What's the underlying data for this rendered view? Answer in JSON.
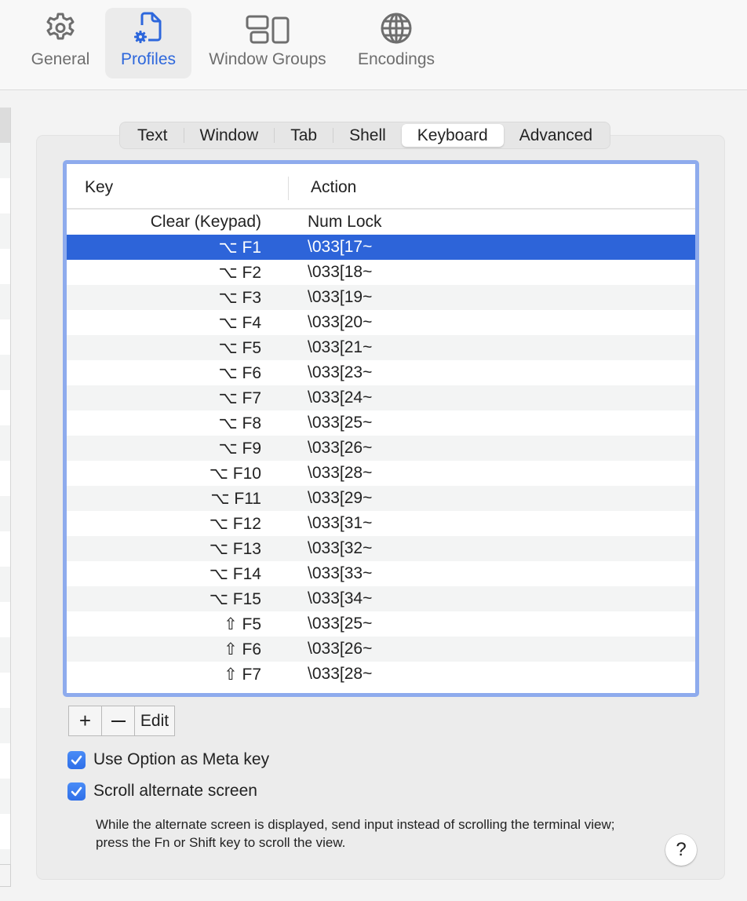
{
  "toolbar": {
    "items": [
      {
        "label": "General",
        "icon": "gear-icon",
        "active": false
      },
      {
        "label": "Profiles",
        "icon": "profile-document-gear-icon",
        "active": true
      },
      {
        "label": "Window Groups",
        "icon": "window-groups-icon",
        "active": false
      },
      {
        "label": "Encodings",
        "icon": "globe-icon",
        "active": false
      }
    ]
  },
  "colors": {
    "accent": "#2d67dc",
    "selection": "#2d64d9",
    "focus_ring": "#8eabed",
    "checkbox": "#3478f6"
  },
  "tabs": {
    "items": [
      "Text",
      "Window",
      "Tab",
      "Shell",
      "Keyboard",
      "Advanced"
    ],
    "selected": "Keyboard"
  },
  "table": {
    "columns": {
      "key": "Key",
      "action": "Action"
    },
    "selected_index": 1,
    "rows": [
      {
        "key": "Clear (Keypad)",
        "action": "Num Lock"
      },
      {
        "key": "⌥ F1",
        "action": "\\033[17~"
      },
      {
        "key": "⌥ F2",
        "action": "\\033[18~"
      },
      {
        "key": "⌥ F3",
        "action": "\\033[19~"
      },
      {
        "key": "⌥ F4",
        "action": "\\033[20~"
      },
      {
        "key": "⌥ F5",
        "action": "\\033[21~"
      },
      {
        "key": "⌥ F6",
        "action": "\\033[23~"
      },
      {
        "key": "⌥ F7",
        "action": "\\033[24~"
      },
      {
        "key": "⌥ F8",
        "action": "\\033[25~"
      },
      {
        "key": "⌥ F9",
        "action": "\\033[26~"
      },
      {
        "key": "⌥ F10",
        "action": "\\033[28~"
      },
      {
        "key": "⌥ F11",
        "action": "\\033[29~"
      },
      {
        "key": "⌥ F12",
        "action": "\\033[31~"
      },
      {
        "key": "⌥ F13",
        "action": "\\033[32~"
      },
      {
        "key": "⌥ F14",
        "action": "\\033[33~"
      },
      {
        "key": "⌥ F15",
        "action": "\\033[34~"
      },
      {
        "key": "⇧ F5",
        "action": "\\033[25~"
      },
      {
        "key": "⇧ F6",
        "action": "\\033[26~"
      },
      {
        "key": "⇧ F7",
        "action": "\\033[28~"
      }
    ]
  },
  "buttons": {
    "add": "+",
    "remove": "—",
    "edit": "Edit"
  },
  "options": {
    "use_option_as_meta": {
      "label": "Use Option as Meta key",
      "checked": true
    },
    "scroll_alternate_screen": {
      "label": "Scroll alternate screen",
      "checked": true
    },
    "help_text": "While the alternate screen is displayed, send input instead of scrolling the terminal view; press the Fn or Shift key to scroll the view."
  },
  "help_button": "?"
}
